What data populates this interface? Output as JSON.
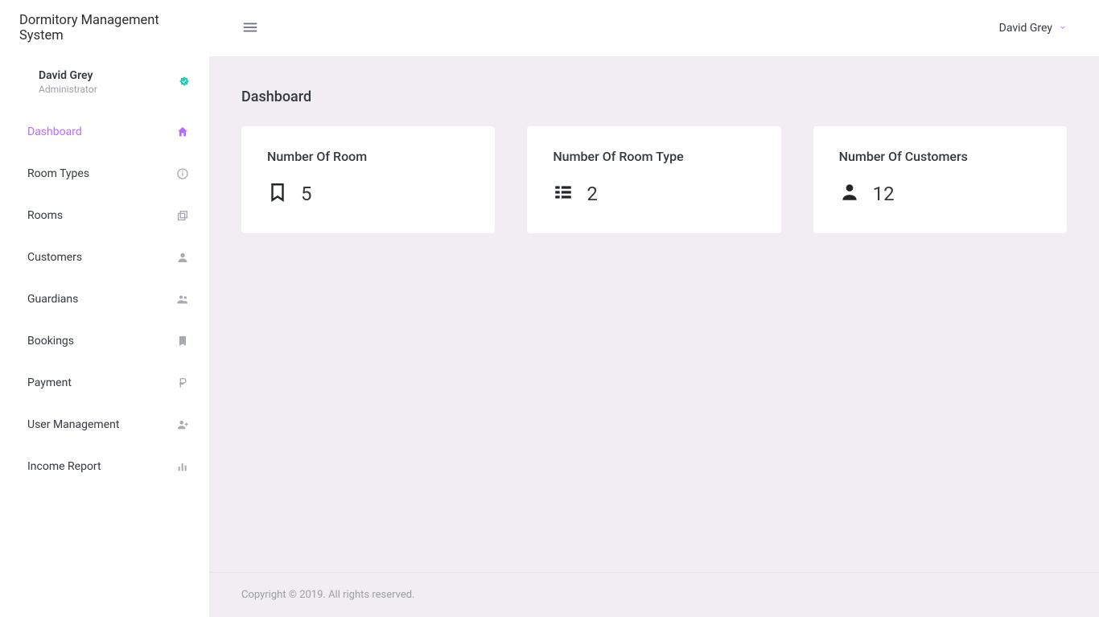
{
  "app_name": "Dormitory Management System",
  "user": {
    "name": "David Grey",
    "role": "Administrator"
  },
  "topbar": {
    "user_name": "David Grey"
  },
  "page": {
    "title": "Dashboard"
  },
  "sidebar": {
    "items": [
      {
        "label": "Dashboard"
      },
      {
        "label": "Room Types"
      },
      {
        "label": "Rooms"
      },
      {
        "label": "Customers"
      },
      {
        "label": "Guardians"
      },
      {
        "label": "Bookings"
      },
      {
        "label": "Payment"
      },
      {
        "label": "User Management"
      },
      {
        "label": "Income Report"
      }
    ]
  },
  "cards": [
    {
      "title": "Number Of Room",
      "value": "5"
    },
    {
      "title": "Number Of Room Type",
      "value": "2"
    },
    {
      "title": "Number Of Customers",
      "value": "12"
    }
  ],
  "footer": {
    "text": "Copyright © 2019. All rights reserved."
  }
}
